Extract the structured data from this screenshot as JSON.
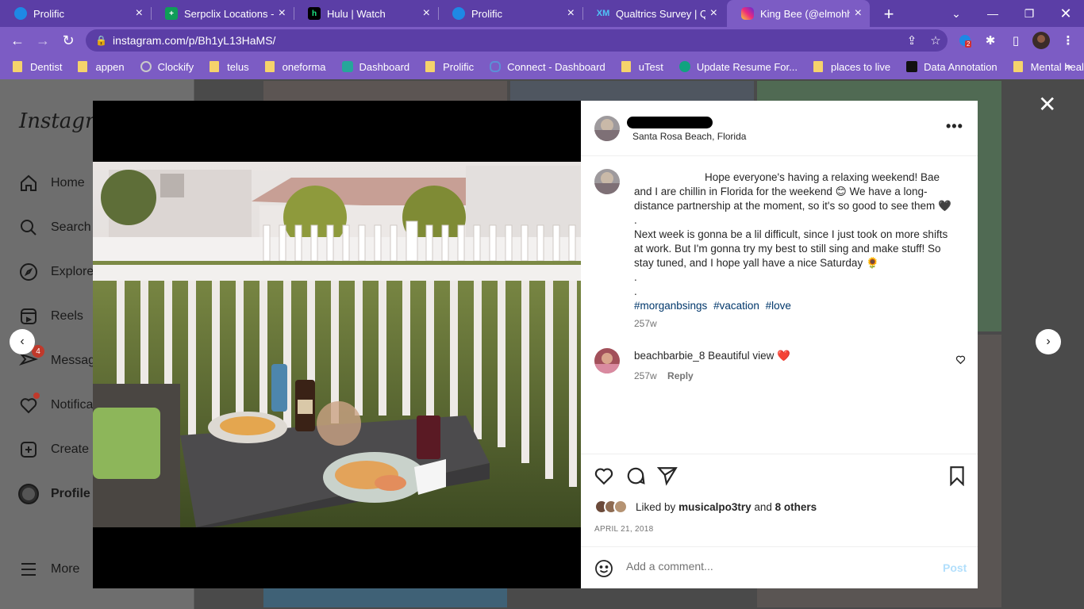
{
  "browser": {
    "tabs": [
      {
        "title": "Prolific",
        "favicon": "prolific-icon",
        "color": "#1e88e5"
      },
      {
        "title": "Serpclix Locations - Go",
        "favicon": "sheets-icon",
        "color": "#0f9d58"
      },
      {
        "title": "Hulu | Watch",
        "favicon": "hulu-icon",
        "color": "#000000"
      },
      {
        "title": "Prolific",
        "favicon": "prolific-icon",
        "color": "#1e88e5"
      },
      {
        "title": "Qualtrics Survey | Qua",
        "favicon": "qualtrics-icon",
        "color": "#1a73e8"
      },
      {
        "title": "King Bee (@elmohhm",
        "favicon": "instagram-icon",
        "color": "#e1306c",
        "active": true
      }
    ],
    "url": "instagram.com/p/Bh1yL13HaMS/",
    "bookmarks": [
      {
        "label": "Dentist",
        "icon": "folder"
      },
      {
        "label": "appen",
        "icon": "folder"
      },
      {
        "label": "Clockify",
        "icon": "clockify"
      },
      {
        "label": "telus",
        "icon": "folder"
      },
      {
        "label": "oneforma",
        "icon": "folder"
      },
      {
        "label": "Dashboard",
        "icon": "dashboard"
      },
      {
        "label": "Prolific",
        "icon": "folder"
      },
      {
        "label": "Connect - Dashboard",
        "icon": "connect"
      },
      {
        "label": "uTest",
        "icon": "folder"
      },
      {
        "label": "Update Resume For...",
        "icon": "openai"
      },
      {
        "label": "places to live",
        "icon": "folder"
      },
      {
        "label": "Data Annotation",
        "icon": "dataannotation"
      },
      {
        "label": "Mental health",
        "icon": "folder"
      }
    ],
    "extension_badge": "2"
  },
  "sidebar": {
    "logo": "Instagram",
    "items": [
      {
        "label": "Home",
        "icon": "home-icon"
      },
      {
        "label": "Search",
        "icon": "search-icon"
      },
      {
        "label": "Explore",
        "icon": "compass-icon"
      },
      {
        "label": "Reels",
        "icon": "reels-icon"
      },
      {
        "label": "Messages",
        "icon": "messenger-icon",
        "badge": "4"
      },
      {
        "label": "Notifications",
        "icon": "heart-icon"
      },
      {
        "label": "Create",
        "icon": "plus-square-icon"
      },
      {
        "label": "Profile",
        "icon": "avatar"
      },
      {
        "label": "More",
        "icon": "hamburger-icon"
      }
    ]
  },
  "post": {
    "location": "Santa Rosa Beach, Florida",
    "caption_lines": [
      "Hope everyone's having a relaxing weekend! Bae and I are chillin in Florida for the weekend 😊 We have a long-distance partnership at the moment, so it's so good to see them 🖤 .",
      "Next week is gonna be a lil difficult, since I just took on more shifts at work. But I'm gonna try my best to still sing and make stuff! So stay tuned, and I hope yall have a nice Saturday 🌻",
      ".",
      "."
    ],
    "hashtags": [
      "#morganbsings",
      "#vacation",
      "#love"
    ],
    "caption_time": "257w",
    "comment": {
      "user": "beachbarbie_8",
      "text": "Beautiful view ❤️",
      "time": "257w",
      "reply_label": "Reply"
    },
    "likes": {
      "prefix": "Liked by",
      "user": "musicalpo3try",
      "and": "and",
      "others": "8 others"
    },
    "date": "APRIL 21, 2018",
    "comment_placeholder": "Add a comment...",
    "post_label": "Post"
  },
  "colors": {
    "tabbar": "#5b3ea6",
    "toolbar": "#7c5cc4",
    "hashtag": "#00376b",
    "post_disabled": "#b2dffc"
  }
}
